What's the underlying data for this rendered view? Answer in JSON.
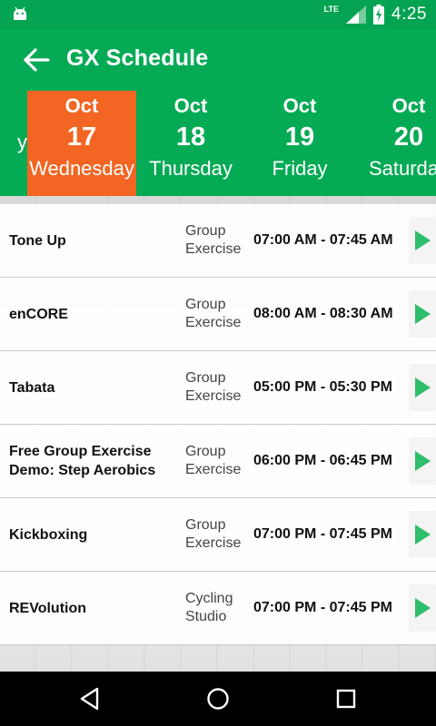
{
  "status_bar": {
    "network": "LTE",
    "time": "4:25",
    "icons": [
      "android-icon",
      "signal-icon",
      "battery-icon"
    ]
  },
  "app_bar": {
    "title": "GX Schedule",
    "back_icon": "arrow-back-icon"
  },
  "dates": [
    {
      "month": "",
      "day": "",
      "weekday": "y"
    },
    {
      "month": "Oct",
      "day": "17",
      "weekday": "Wednesday",
      "selected": true
    },
    {
      "month": "Oct",
      "day": "18",
      "weekday": "Thursday"
    },
    {
      "month": "Oct",
      "day": "19",
      "weekday": "Friday"
    },
    {
      "month": "Oct",
      "day": "20",
      "weekday": "Saturday"
    }
  ],
  "schedule": [
    {
      "name": "Tone Up",
      "location": "Group Exercise",
      "time": "07:00 AM - 07:45 AM"
    },
    {
      "name": "enCORE",
      "location": "Group Exercise",
      "time": "08:00 AM - 08:30 AM"
    },
    {
      "name": "Tabata",
      "location": "Group Exercise",
      "time": "05:00 PM - 05:30 PM"
    },
    {
      "name": "Free Group Exercise Demo: Step Aerobics",
      "location": "Group Exercise",
      "time": "06:00 PM - 06:45 PM"
    },
    {
      "name": "Kickboxing",
      "location": "Group Exercise",
      "time": "07:00 PM - 07:45 PM"
    },
    {
      "name": "REVolution",
      "location": "Cycling Studio",
      "time": "07:00 PM - 07:45 PM"
    }
  ],
  "colors": {
    "status_bar": "#04a351",
    "primary": "#05aa55",
    "selected_date": "#f26522",
    "play_icon": "#2ebd6b",
    "nav_bar": "#000000"
  },
  "nav_bar": {
    "icons": [
      "back-triangle-icon",
      "home-circle-icon",
      "recents-square-icon"
    ]
  }
}
